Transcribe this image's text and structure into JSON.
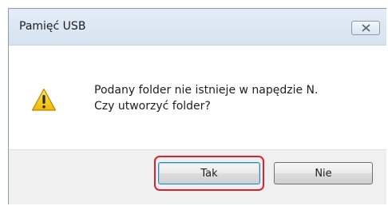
{
  "dialog": {
    "title": "Pamięć USB",
    "message_line1": "Podany folder nie istnieje w napędzie N.",
    "message_line2": "Czy utworzyć folder?",
    "icon": "warning-icon"
  },
  "buttons": {
    "yes_label": "Tak",
    "no_label": "Nie"
  },
  "colors": {
    "highlight": "#d9232f",
    "warning_yellow": "#f5c400",
    "titlebar": "#dce6f2"
  }
}
